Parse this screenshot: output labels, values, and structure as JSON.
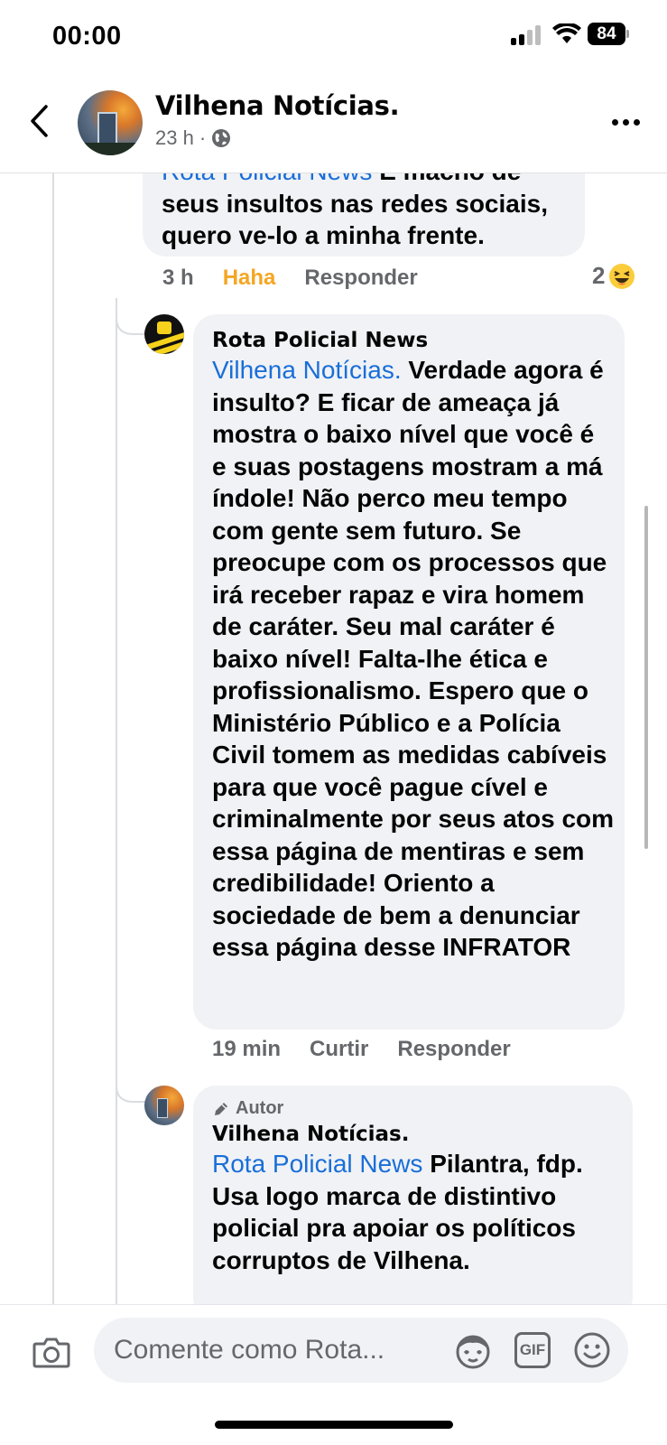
{
  "status": {
    "time": "00:00",
    "battery": "84"
  },
  "header": {
    "name": "Vilhena Notícias.",
    "age": "23 h",
    "dot": "·"
  },
  "comment1": {
    "mention": "Rota Policial News",
    "text_cut": " É macho de",
    "text": "seus insultos nas redes sociais, quero ve-lo a minha frente.",
    "time": "3 h",
    "reaction_label": "Haha",
    "reply_label": "Responder",
    "reaction_count": "2"
  },
  "comment2": {
    "author": "Rota Policial News",
    "mention": "Vilhena Notícias.",
    "text": " Verdade agora é insulto? E ficar de ameaça já mostra o baixo nível que você é e suas postagens mostram a má índole! Não perco meu tempo com gente sem futuro. Se preocupe com os processos que irá receber rapaz e vira homem de caráter. Seu mal caráter é baixo nível! Falta-lhe ética e profissionalismo. Espero que o Ministério Público e a Polícia Civil tomem as medidas cabíveis para que você pague cível e criminalmente por seus atos com essa página de mentiras e sem credibilidade! Oriento a sociedade de bem a denunciar essa página desse INFRATOR",
    "time": "19 min",
    "like_label": "Curtir",
    "reply_label": "Responder"
  },
  "comment3": {
    "badge": "Autor",
    "author": "Vilhena Notícias.",
    "mention": "Rota Policial News",
    "text": " Pilantra, fdp. Usa logo marca de distintivo policial pra apoiar os políticos corruptos de Vilhena."
  },
  "composer": {
    "placeholder": "Comente como Rota...",
    "gif_label": "GIF"
  },
  "colors": {
    "mention": "#1a6ed8",
    "haha": "#f5a623",
    "bubble": "#f0f2f5",
    "meta": "#65676b"
  }
}
